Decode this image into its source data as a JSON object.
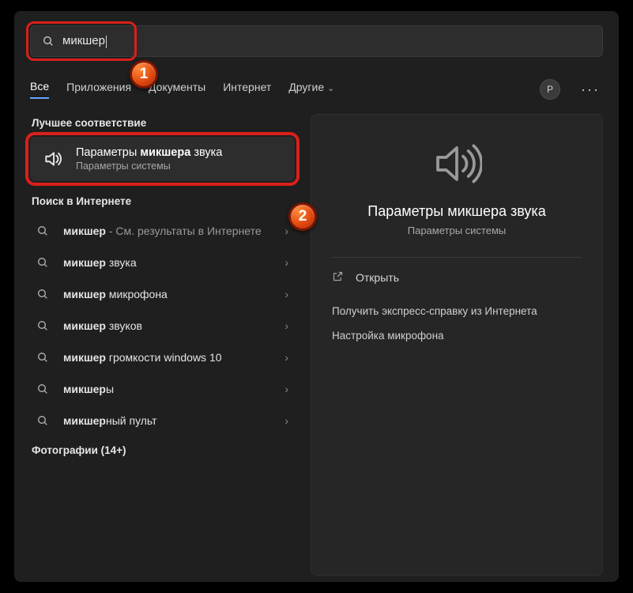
{
  "search": {
    "query": "микшер"
  },
  "tabs": {
    "all": "Все",
    "apps": "Приложения",
    "docs": "Документы",
    "web": "Интернет",
    "more": "Другие"
  },
  "avatar_initial": "P",
  "left": {
    "best_header": "Лучшее соответствие",
    "best": {
      "title_pre": "Параметры ",
      "title_bold": "микшера",
      "title_post": " звука",
      "subtitle": "Параметры системы"
    },
    "web_header": "Поиск в Интернете",
    "web_items": [
      {
        "pre": "",
        "bold": "микшер",
        "post": "",
        "trail": " - См. результаты в Интернете"
      },
      {
        "pre": "",
        "bold": "микшер",
        "post": " звука",
        "trail": ""
      },
      {
        "pre": "",
        "bold": "микшер",
        "post": " микрофона",
        "trail": ""
      },
      {
        "pre": "",
        "bold": "микшер",
        "post": " звуков",
        "trail": ""
      },
      {
        "pre": "",
        "bold": "микшер",
        "post": " громкости windows 10",
        "trail": ""
      },
      {
        "pre": "",
        "bold": "микшер",
        "post": "ы",
        "trail": ""
      },
      {
        "pre": "",
        "bold": "микшер",
        "post": "ный пульт",
        "trail": ""
      }
    ],
    "photos_header": "Фотографии (14+)"
  },
  "right": {
    "title": "Параметры микшера звука",
    "subtitle": "Параметры системы",
    "open": "Открыть",
    "help_header": "Получить экспресс-справку из Интернета",
    "help_link": "Настройка микрофона"
  },
  "annotations": {
    "b1": "1",
    "b2": "2"
  }
}
